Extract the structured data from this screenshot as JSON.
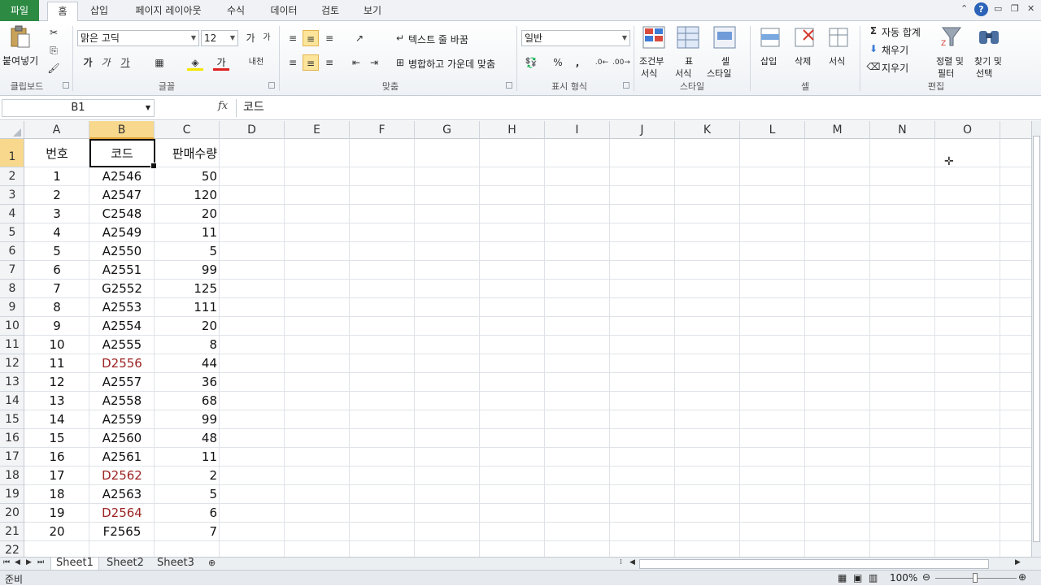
{
  "ribbon_tabs": [
    "파일",
    "홈",
    "삽입",
    "페이지 레이아웃",
    "수식",
    "데이터",
    "검토",
    "보기"
  ],
  "clipboard": {
    "paste": "붙여넣기",
    "label": "클립보드"
  },
  "font": {
    "name": "맑은 고딕",
    "size": "12",
    "label": "글꼴"
  },
  "alignment": {
    "wrap": "텍스트 줄 바꿈",
    "merge": "병합하고 가운데 맞춤",
    "label": "맞춤"
  },
  "number": {
    "format": "일반",
    "label": "표시 형식"
  },
  "styles": {
    "cond_line1": "조건부",
    "cond_line2": "서식",
    "table_line1": "표",
    "table_line2": "서식",
    "cell_line1": "셀",
    "cell_line2": "스타일",
    "label": "스타일"
  },
  "cells": {
    "insert": "삽입",
    "delete": "삭제",
    "format": "서식",
    "label": "셀"
  },
  "editing": {
    "autosum": "자동 합계",
    "fill": "채우기",
    "clear": "지우기",
    "sort_line1": "정렬 및",
    "sort_line2": "필터",
    "find_line1": "찾기 및",
    "find_line2": "선택",
    "label": "편집"
  },
  "name_box": "B1",
  "formula_value": "코드",
  "fx_label": "fx",
  "columns": [
    "A",
    "B",
    "C",
    "D",
    "E",
    "F",
    "G",
    "H",
    "I",
    "J",
    "K",
    "L",
    "M",
    "N",
    "O"
  ],
  "row_numbers": [
    "1",
    "2",
    "3",
    "4",
    "5",
    "6",
    "7",
    "8",
    "9",
    "10",
    "11",
    "12",
    "13",
    "14",
    "15",
    "16",
    "17",
    "18",
    "19",
    "20",
    "21",
    "22"
  ],
  "headers": [
    "번호",
    "코드",
    "판매수량"
  ],
  "rows": [
    {
      "no": "1",
      "code": "A2546",
      "qty": "50",
      "red": false
    },
    {
      "no": "2",
      "code": "A2547",
      "qty": "120",
      "red": false
    },
    {
      "no": "3",
      "code": "C2548",
      "qty": "20",
      "red": false
    },
    {
      "no": "4",
      "code": "A2549",
      "qty": "11",
      "red": false
    },
    {
      "no": "5",
      "code": "A2550",
      "qty": "5",
      "red": false
    },
    {
      "no": "6",
      "code": "A2551",
      "qty": "99",
      "red": false
    },
    {
      "no": "7",
      "code": "G2552",
      "qty": "125",
      "red": false
    },
    {
      "no": "8",
      "code": "A2553",
      "qty": "111",
      "red": false
    },
    {
      "no": "9",
      "code": "A2554",
      "qty": "20",
      "red": false
    },
    {
      "no": "10",
      "code": "A2555",
      "qty": "8",
      "red": false
    },
    {
      "no": "11",
      "code": "D2556",
      "qty": "44",
      "red": true
    },
    {
      "no": "12",
      "code": "A2557",
      "qty": "36",
      "red": false
    },
    {
      "no": "13",
      "code": "A2558",
      "qty": "68",
      "red": false
    },
    {
      "no": "14",
      "code": "A2559",
      "qty": "99",
      "red": false
    },
    {
      "no": "15",
      "code": "A2560",
      "qty": "48",
      "red": false
    },
    {
      "no": "16",
      "code": "A2561",
      "qty": "11",
      "red": false
    },
    {
      "no": "17",
      "code": "D2562",
      "qty": "2",
      "red": true
    },
    {
      "no": "18",
      "code": "A2563",
      "qty": "5",
      "red": false
    },
    {
      "no": "19",
      "code": "D2564",
      "qty": "6",
      "red": true
    },
    {
      "no": "20",
      "code": "F2565",
      "qty": "7",
      "red": false
    }
  ],
  "sheets": [
    "Sheet1",
    "Sheet2",
    "Sheet3"
  ],
  "status": {
    "ready": "준비",
    "zoom": "100%"
  },
  "colors": {
    "accent": "#2c8a43",
    "selection": "#f7d88c",
    "red_text": "#9c2222"
  }
}
